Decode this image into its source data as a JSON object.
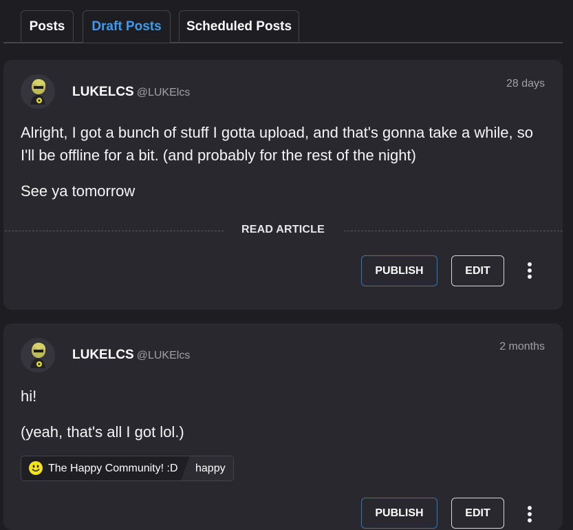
{
  "tabs": [
    {
      "label": "Posts"
    },
    {
      "label": "Draft Posts"
    },
    {
      "label": "Scheduled Posts"
    }
  ],
  "active_tab": "Draft Posts",
  "accent_color": "#3d9cf0",
  "posts": [
    {
      "username": "LUKELCS",
      "handle": "@LUKElcs",
      "time": "28 days",
      "paragraphs": [
        "Alright, I got a bunch of stuff I gotta upload, and that's gonna take a while, so I'll be offline for a bit. (and probably for the rest of the night)",
        "See ya tomorrow"
      ],
      "read_label": "READ ARTICLE",
      "publish_label": "PUBLISH",
      "edit_label": "EDIT",
      "more_icon": "vertical-dots-icon"
    },
    {
      "username": "LUKELCS",
      "handle": "@LUKElcs",
      "time": "2 months",
      "paragraphs": [
        "hi!",
        "(yeah, that's all I got lol.)"
      ],
      "community": {
        "name": "The Happy Community! :D",
        "tag": "happy",
        "icon": "smiley-icon"
      },
      "publish_label": "PUBLISH",
      "edit_label": "EDIT",
      "more_icon": "vertical-dots-icon"
    }
  ]
}
